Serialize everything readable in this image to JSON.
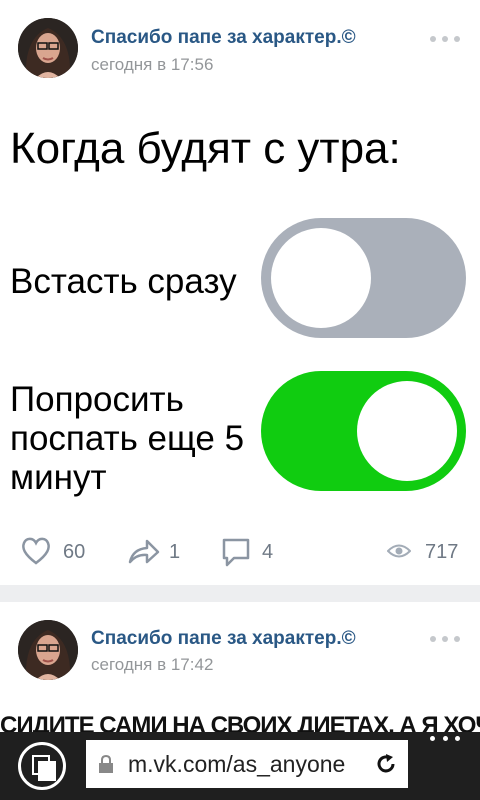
{
  "posts": [
    {
      "author": "Спасибо папе за характер.©",
      "time": "сегодня в 17:56",
      "meme": {
        "title": "Когда будят с утра:",
        "option1": "Встасть сразу",
        "option2": "Попросить поспать еще 5 минут",
        "toggle1_on": false,
        "toggle2_on": true
      },
      "actions": {
        "likes": "60",
        "shares": "1",
        "comments": "4",
        "views": "717"
      }
    },
    {
      "author": "Спасибо папе за характер.©",
      "time": "сегодня в 17:42",
      "meme_text": "СИДИТЕ САМИ НА СВОИХ ДИЕТАХ, А Я ХОЧУ"
    }
  ],
  "browser": {
    "url": "m.vk.com/as_anyone",
    "icons": [
      "tabs-icon",
      "lock-icon",
      "reload-icon",
      "more-icon"
    ]
  },
  "colors": {
    "link": "#2a5885",
    "toggle_off": "#aab0ba",
    "toggle_on": "#10cc10",
    "meta": "#939699"
  }
}
